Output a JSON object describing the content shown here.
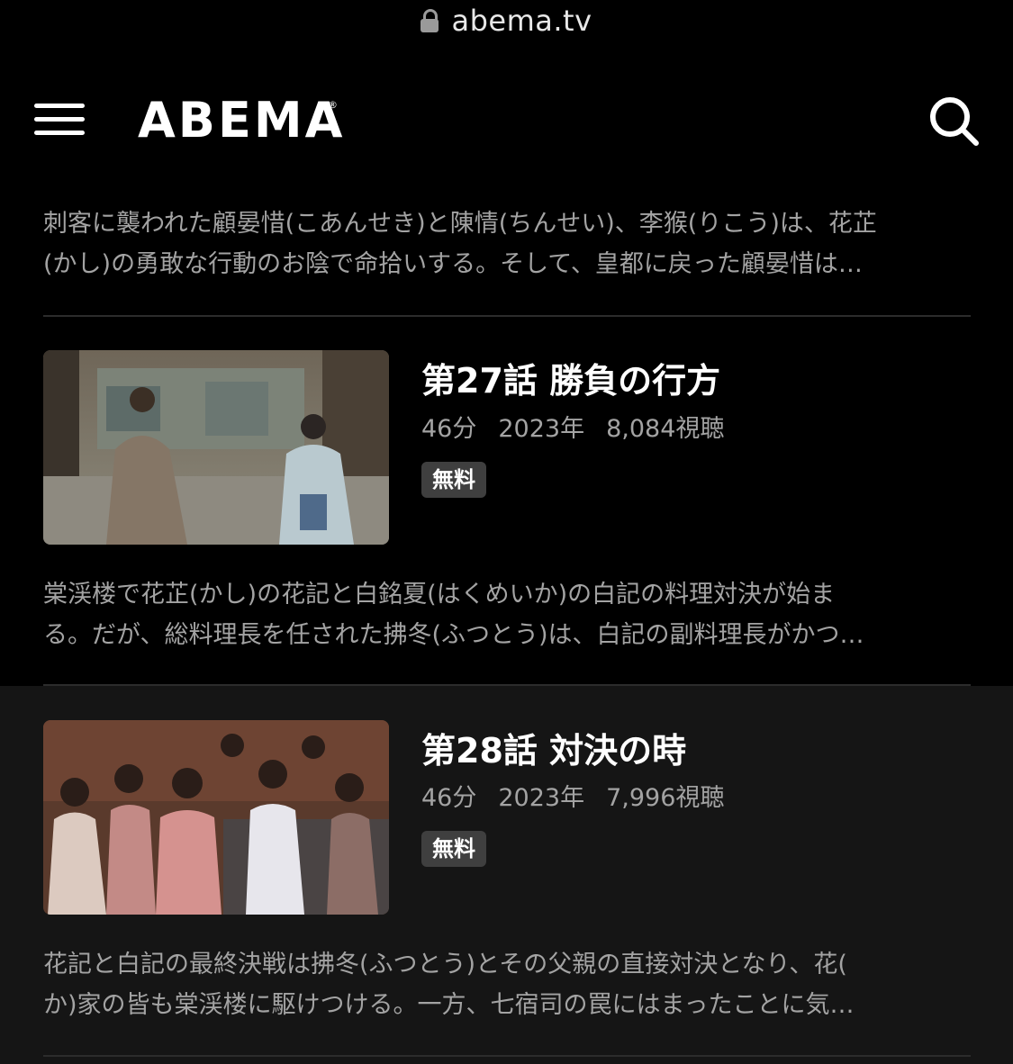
{
  "browser": {
    "url": "abema.tv"
  },
  "header": {
    "logo": "ABEMA",
    "logo_mark": "®"
  },
  "previous_episode": {
    "description": "刺客に襲われた顧晏惜(こあんせき)と陳情(ちんせい)、李猴(りこう)は、花芷\n(かし)の勇敢な行動のお陰で命拾いする。そして、皇都に戻った顧晏惜は…"
  },
  "episodes": [
    {
      "title": "第27話 勝負の行方",
      "duration": "46分",
      "year": "2023年",
      "views": "8,084視聴",
      "badge": "無料",
      "description": "棠渓楼で花芷(かし)の花記と白銘夏(はくめいか)の白記の料理対決が始ま\nる。だが、総料理長を任された拂冬(ふつとう)は、白記の副料理長がかつ…"
    },
    {
      "title": "第28話 対決の時",
      "duration": "46分",
      "year": "2023年",
      "views": "7,996視聴",
      "badge": "無料",
      "description": "花記と白記の最終決戦は拂冬(ふつとう)とその父親の直接対決となり、花(\nか)家の皆も棠渓楼に駆けつける。一方、七宿司の罠にはまったことに気…"
    }
  ],
  "colors": {
    "background": "#000000",
    "highlight_row": "#151515",
    "muted_text": "#a3a3a3",
    "badge_bg": "#3f3f3f"
  }
}
